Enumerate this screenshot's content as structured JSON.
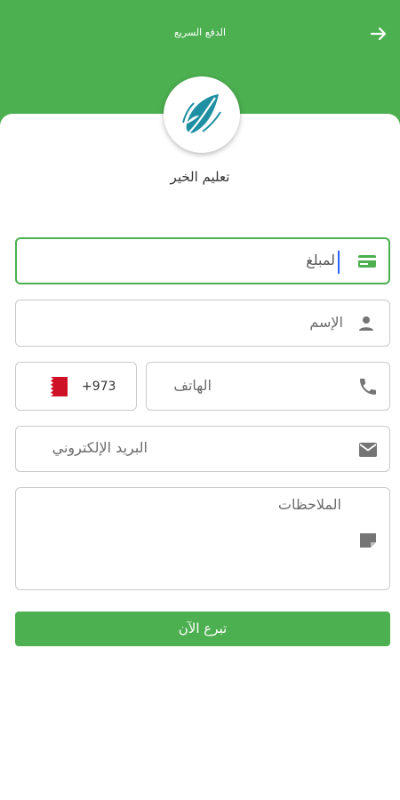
{
  "header": {
    "title": "الدفع السريع",
    "back_icon": "arrow-right-icon"
  },
  "organization": {
    "name": "تعليم الخير"
  },
  "form": {
    "amount": {
      "value": "لمبلغ",
      "icon": "credit-card-icon"
    },
    "name": {
      "placeholder": "الإسم",
      "icon": "person-icon"
    },
    "phone": {
      "placeholder": "الهاتف",
      "icon": "phone-icon",
      "country_code": "+973",
      "country_flag": "bahrain-flag"
    },
    "email": {
      "placeholder": "البريد الإلكتروني",
      "icon": "email-icon"
    },
    "notes": {
      "placeholder": "الملاحظات",
      "icon": "note-icon"
    },
    "submit_label": "تبرع الآن"
  },
  "colors": {
    "primary": "#4caf50",
    "flag_red": "#ce1126",
    "icon": "#757575",
    "caret": "#2962ff"
  }
}
